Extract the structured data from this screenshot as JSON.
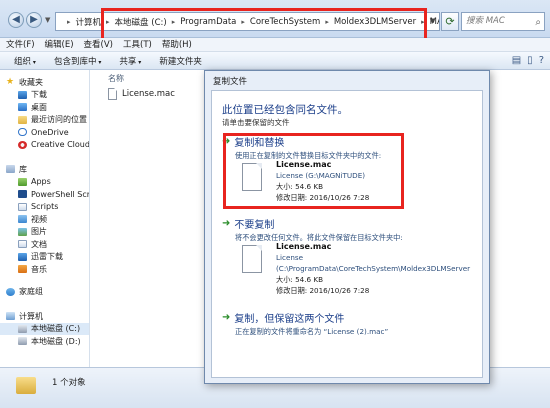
{
  "address": {
    "crumbs": [
      "计算机",
      "本地磁盘 (C:)",
      "ProgramData",
      "CoreTechSystem",
      "Moldex3DLMServer",
      "MAC"
    ],
    "search_placeholder": "搜索 MAC"
  },
  "menu": [
    "文件(F)",
    "编辑(E)",
    "查看(V)",
    "工具(T)",
    "帮助(H)"
  ],
  "toolbar": [
    "组织",
    "包含到库中",
    "共享",
    "新建文件夹"
  ],
  "nav": {
    "favorites_label": "收藏夹",
    "favorites": [
      "下载",
      "桌面",
      "最近访问的位置",
      "OneDrive",
      "Creative Cloud"
    ],
    "library_label": "库",
    "library": [
      "Apps",
      "PowerShell Scri",
      "Scripts",
      "视频",
      "图片",
      "文档",
      "迅雷下载",
      "音乐"
    ],
    "home_label": "家庭组",
    "computer_label": "计算机",
    "drives": [
      "本地磁盘 (C:)",
      "本地磁盘 (D:)"
    ]
  },
  "filelist": {
    "column_name": "名称",
    "files": [
      "License.mac"
    ]
  },
  "status": {
    "count_text": "1 个对象"
  },
  "dialog": {
    "title": "复制文件",
    "heading": "此位置已经包含同名文件。",
    "subheading": "请单击要保留的文件",
    "option_replace": {
      "title": "复制和替换",
      "desc": "使用正在复制的文件替换目标文件夹中的文件:",
      "file_name": "License.mac",
      "file_path": "License (G:\\MAGNiTUDE)",
      "size": "大小: 54.6 KB",
      "modified": "修改日期: 2016/10/26 7:28"
    },
    "option_skip": {
      "title": "不要复制",
      "desc": "将不会更改任何文件。将此文件保留在目标文件夹中:",
      "file_name": "License.mac",
      "file_path_1": "License",
      "file_path_2": "(C:\\ProgramData\\CoreTechSystem\\Moldex3DLMServer",
      "size": "大小: 54.6 KB",
      "modified": "修改日期: 2016/10/26 7:28"
    },
    "option_keep_both": {
      "title": "复制，但保留这两个文件",
      "desc": "正在复制的文件将重命名为 “License (2).mac”"
    }
  }
}
